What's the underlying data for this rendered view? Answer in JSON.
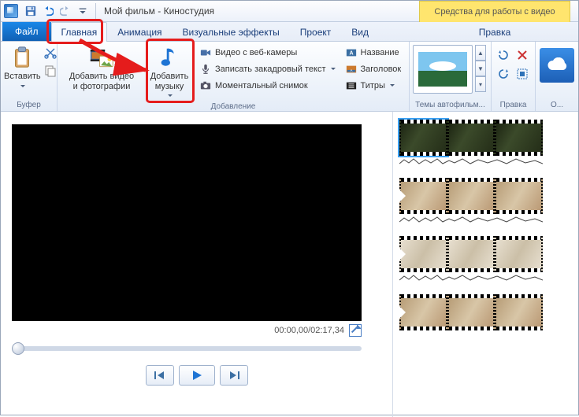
{
  "title": "Мой фильм - Киностудия",
  "context_tab": "Средства для работы с видео",
  "tabs": {
    "file": "Файл",
    "home": "Главная",
    "anim": "Анимация",
    "fx": "Визуальные эффекты",
    "project": "Проект",
    "view": "Вид",
    "edit": "Правка"
  },
  "ribbon": {
    "clipboard": {
      "paste": "Вставить",
      "group": "Буфер"
    },
    "add": {
      "videos_photos": "Добавить видео\nи фотографии",
      "music": "Добавить\nмузыку",
      "webcam": "Видео с веб-камеры",
      "narration": "Записать закадровый текст",
      "snapshot": "Моментальный снимок",
      "title": "Название",
      "caption": "Заголовок",
      "credits": "Титры",
      "group": "Добавление"
    },
    "themes": {
      "group": "Темы автофильм..."
    },
    "edit_group": {
      "group": "Правка"
    },
    "share_group": {
      "group": "О..."
    }
  },
  "player": {
    "time": "00:00,00/02:17,34"
  }
}
